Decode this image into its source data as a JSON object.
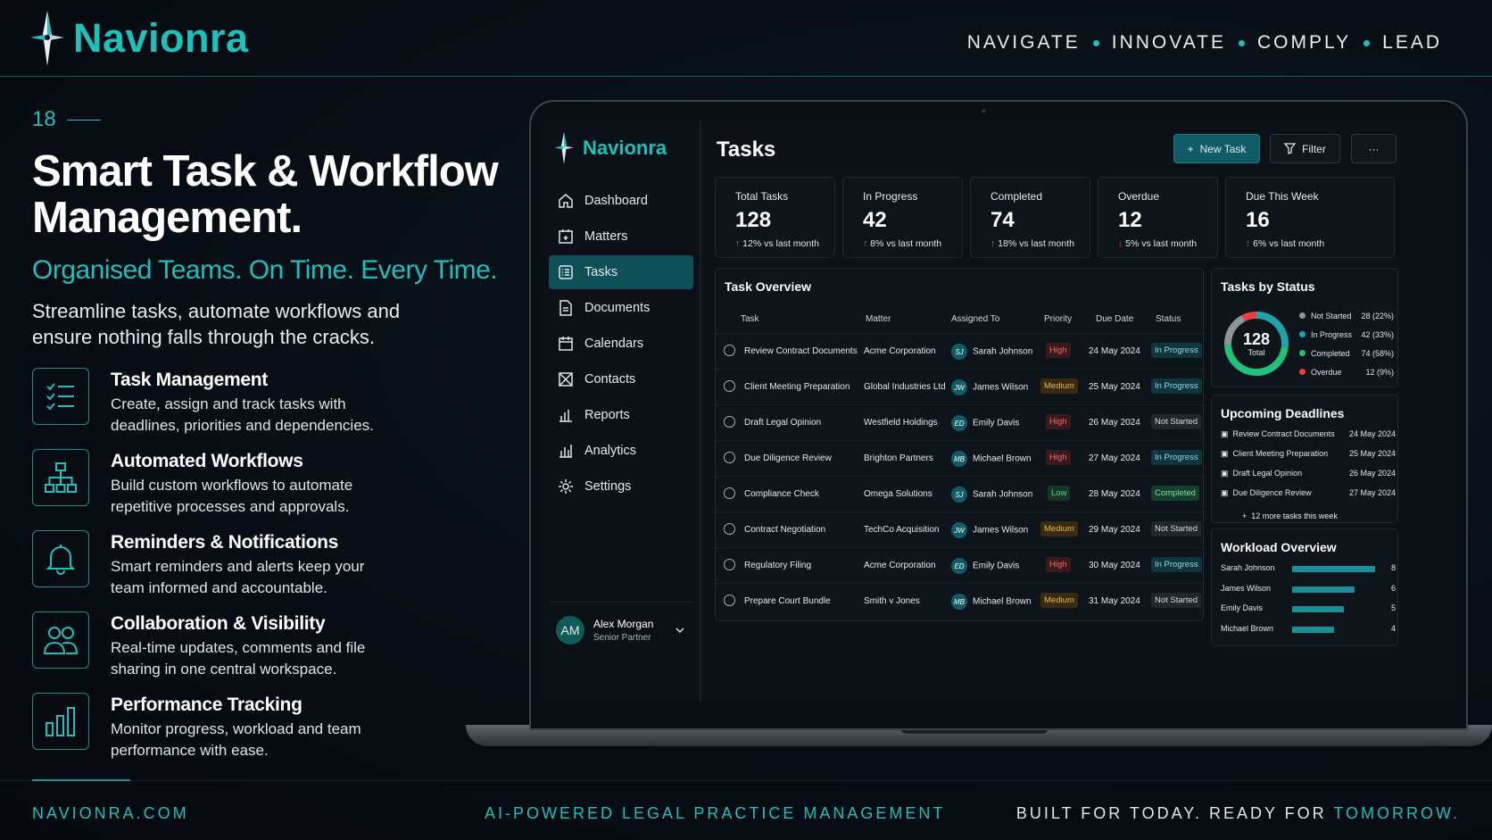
{
  "brand": {
    "name": "Navionra",
    "tagline": [
      "NAVIGATE",
      "INNOVATE",
      "COMPLY",
      "LEAD"
    ]
  },
  "hero": {
    "slide_number": "18",
    "title": "Smart Task & Workflow Management.",
    "subtitle": "Organised Teams. On Time. Every Time.",
    "description": "Streamline tasks, automate workflows and ensure nothing falls through the cracks."
  },
  "features": [
    {
      "icon": "checklist-icon",
      "title": "Task Management",
      "text": "Create, assign and track tasks with deadlines, priorities and dependencies."
    },
    {
      "icon": "workflow-icon",
      "title": "Automated Workflows",
      "text": "Build custom workflows to automate repetitive processes and approvals."
    },
    {
      "icon": "bell-icon",
      "title": "Reminders & Notifications",
      "text": "Smart reminders and alerts keep your team informed and accountable."
    },
    {
      "icon": "users-icon",
      "title": "Collaboration & Visibility",
      "text": "Real-time updates, comments and file sharing in one central workspace."
    },
    {
      "icon": "bar-chart-icon",
      "title": "Performance Tracking",
      "text": "Monitor progress, workload and team performance with ease."
    }
  ],
  "footer": {
    "left": "NAVIONRA.COM",
    "center": "AI-POWERED LEGAL PRACTICE MANAGEMENT",
    "right_a": "BUILT FOR TODAY. READY FOR ",
    "right_b": "TOMORROW."
  },
  "app": {
    "brand": "Navionra",
    "nav": [
      {
        "label": "Dashboard",
        "icon": "home-icon"
      },
      {
        "label": "Matters",
        "icon": "briefcase-icon"
      },
      {
        "label": "Tasks",
        "icon": "tasks-icon",
        "active": true
      },
      {
        "label": "Documents",
        "icon": "document-icon"
      },
      {
        "label": "Calendars",
        "icon": "calendar-icon"
      },
      {
        "label": "Contacts",
        "icon": "contacts-icon"
      },
      {
        "label": "Reports",
        "icon": "reports-icon"
      },
      {
        "label": "Analytics",
        "icon": "analytics-icon"
      },
      {
        "label": "Settings",
        "icon": "gear-icon"
      }
    ],
    "user": {
      "initials": "AM",
      "name": "Alex Morgan",
      "role": "Senior Partner"
    },
    "page_title": "Tasks",
    "buttons": {
      "new_task": "New Task",
      "filter": "Filter",
      "more": "···"
    },
    "stats": [
      {
        "title": "Total Tasks",
        "value": "128",
        "delta": "12% vs last month",
        "dir": "up"
      },
      {
        "title": "In Progress",
        "value": "42",
        "delta": "8% vs last month",
        "dir": "up"
      },
      {
        "title": "Completed",
        "value": "74",
        "delta": "18% vs last month",
        "dir": "up"
      },
      {
        "title": "Overdue",
        "value": "12",
        "delta": "5% vs last month",
        "dir": "down"
      },
      {
        "title": "Due This Week",
        "value": "16",
        "delta": "6% vs last month",
        "dir": "up"
      }
    ],
    "task_overview": {
      "title": "Task Overview",
      "columns": [
        "Task",
        "Matter",
        "Assigned To",
        "Priority",
        "Due Date",
        "Status"
      ],
      "rows": [
        {
          "task": "Review Contract Documents",
          "matter": "Acme Corporation",
          "initials": "SJ",
          "assignee": "Sarah Johnson",
          "priority": "High",
          "due": "24 May 2024",
          "status": "In Progress"
        },
        {
          "task": "Client Meeting Preparation",
          "matter": "Global Industries Ltd",
          "initials": "JW",
          "assignee": "James Wilson",
          "priority": "Medium",
          "due": "25 May 2024",
          "status": "In Progress"
        },
        {
          "task": "Draft Legal Opinion",
          "matter": "Westfield Holdings",
          "initials": "ED",
          "assignee": "Emily Davis",
          "priority": "High",
          "due": "26 May 2024",
          "status": "Not Started"
        },
        {
          "task": "Due Diligence Review",
          "matter": "Brighton Partners",
          "initials": "MB",
          "assignee": "Michael Brown",
          "priority": "High",
          "due": "27 May 2024",
          "status": "In Progress"
        },
        {
          "task": "Compliance Check",
          "matter": "Omega Solutions",
          "initials": "SJ",
          "assignee": "Sarah Johnson",
          "priority": "Low",
          "due": "28 May 2024",
          "status": "Completed"
        },
        {
          "task": "Contract Negotiation",
          "matter": "TechCo Acquisition",
          "initials": "JW",
          "assignee": "James Wilson",
          "priority": "Medium",
          "due": "29 May 2024",
          "status": "Not Started"
        },
        {
          "task": "Regulatory Filing",
          "matter": "Acme Corporation",
          "initials": "ED",
          "assignee": "Emily Davis",
          "priority": "High",
          "due": "30 May 2024",
          "status": "In Progress"
        },
        {
          "task": "Prepare Court Bundle",
          "matter": "Smith v Jones",
          "initials": "MB",
          "assignee": "Michael Brown",
          "priority": "Medium",
          "due": "31 May 2024",
          "status": "Not Started"
        }
      ]
    },
    "tasks_by_status": {
      "title": "Tasks by Status",
      "total": "128",
      "total_label": "Total",
      "items": [
        {
          "label": "Not Started",
          "value": "28 (22%)",
          "count": 28,
          "color": "#8a959e"
        },
        {
          "label": "In Progress",
          "value": "42 (33%)",
          "count": 42,
          "color": "#1fa3a8"
        },
        {
          "label": "Completed",
          "value": "74 (58%)",
          "count": 74,
          "color": "#22c07a"
        },
        {
          "label": "Overdue",
          "value": "12 (9%)",
          "count": 12,
          "color": "#ef3d3d"
        }
      ]
    },
    "upcoming": {
      "title": "Upcoming Deadlines",
      "items": [
        {
          "task": "Review Contract Documents",
          "date": "24 May 2024"
        },
        {
          "task": "Client Meeting Preparation",
          "date": "25 May 2024"
        },
        {
          "task": "Draft Legal Opinion",
          "date": "26 May 2024"
        },
        {
          "task": "Due Diligence Review",
          "date": "27 May 2024"
        }
      ],
      "more": "12 more tasks this week"
    },
    "workload": {
      "title": "Workload Overview",
      "items": [
        {
          "name": "Sarah Johnson",
          "value": 8
        },
        {
          "name": "James Wilson",
          "value": 6
        },
        {
          "name": "Emily Davis",
          "value": 5
        },
        {
          "name": "Michael Brown",
          "value": 4
        }
      ]
    }
  }
}
